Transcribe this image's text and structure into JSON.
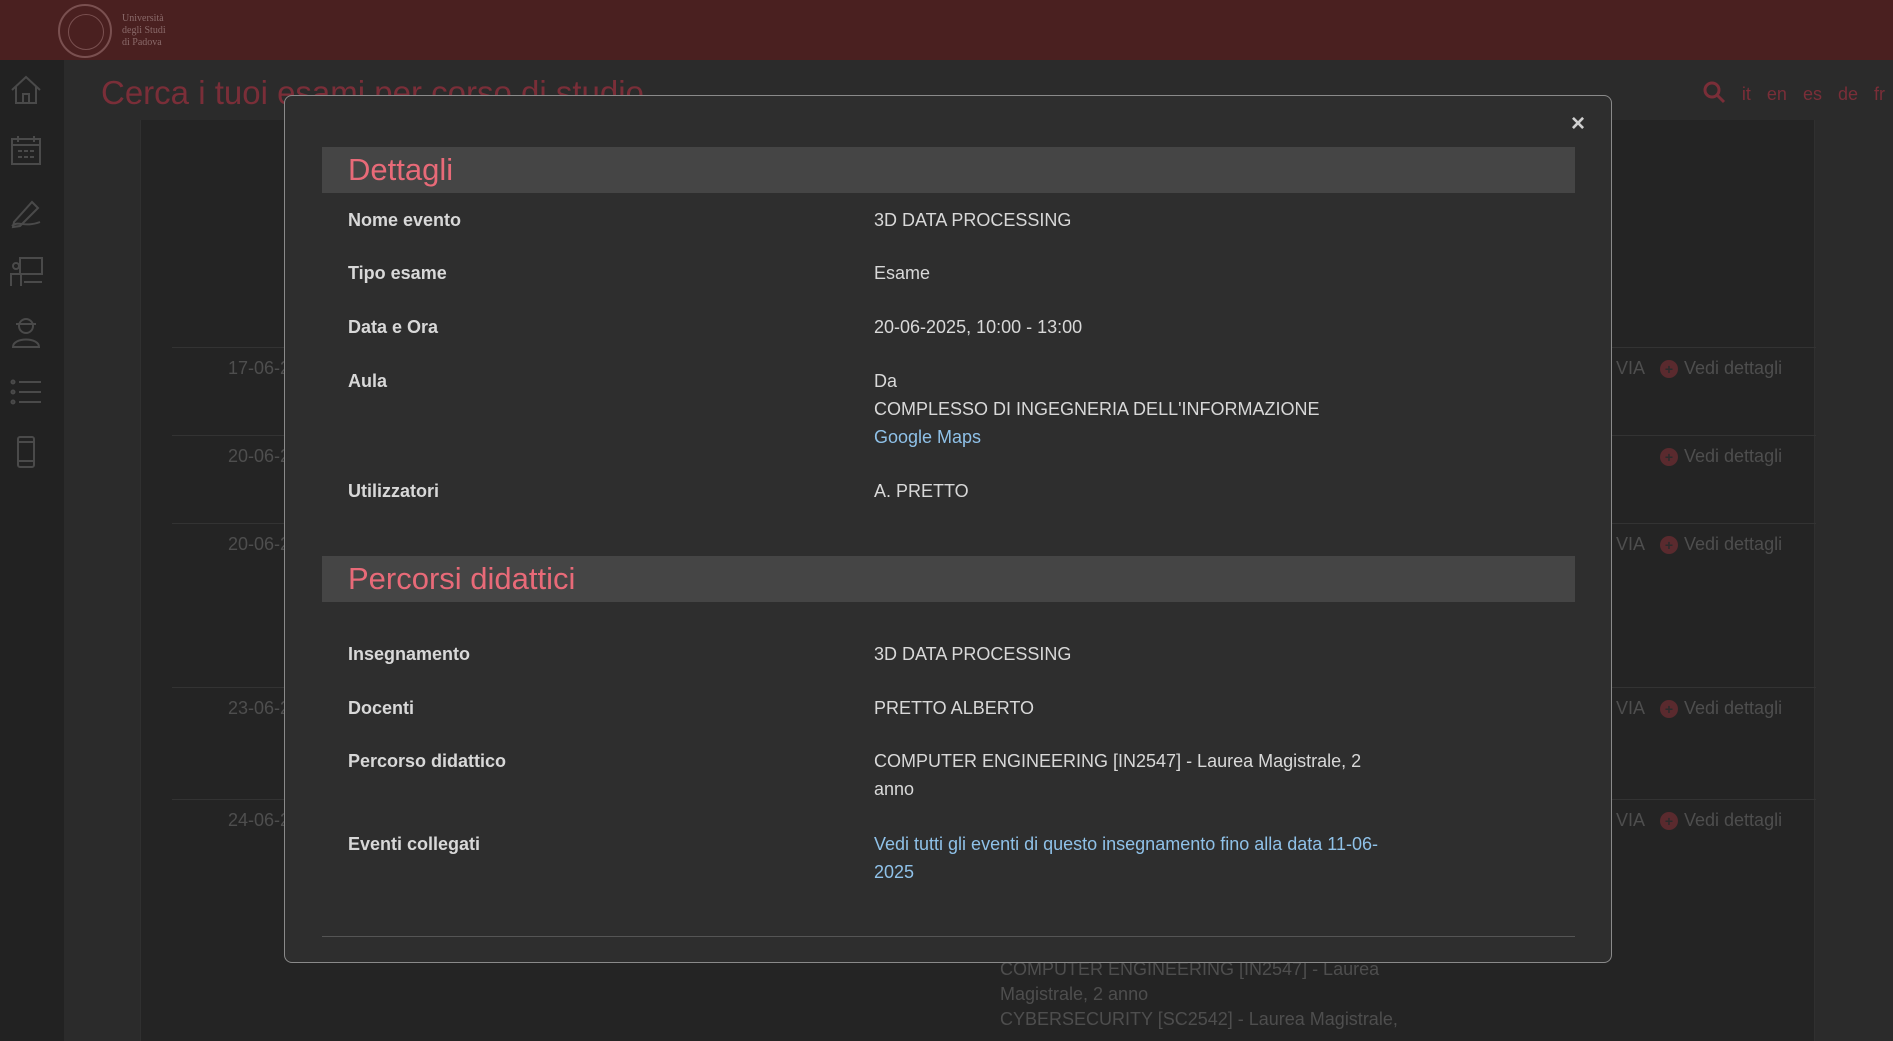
{
  "header": {
    "logo_lines": [
      "Università",
      "degli Studi",
      "di Padova"
    ]
  },
  "page": {
    "title": "Cerca i tuoi esami per corso di studio"
  },
  "languages": [
    "it",
    "en",
    "es",
    "de",
    "fr"
  ],
  "sidebar": {
    "icons": [
      "home-icon",
      "calendar-icon",
      "pen-icon",
      "classroom-icon",
      "student-icon",
      "list-icon",
      "mobile-icon"
    ]
  },
  "background_rows": [
    {
      "date": "17-06-2",
      "via": "VIA",
      "details": "Vedi dettagli"
    },
    {
      "date": "20-06-2",
      "via": "",
      "details": "Vedi dettagli"
    },
    {
      "date": "20-06-2",
      "via": "VIA",
      "details": "Vedi dettagli"
    },
    {
      "date": "23-06-2",
      "via": "VIA",
      "details": "Vedi dettagli"
    },
    {
      "date": "24-06-2",
      "via": "VIA",
      "details": "Vedi dettagli"
    }
  ],
  "background_bottom": [
    "COMPUTER ENGINEERING [IN2547] - Laurea",
    "Magistrale, 2 anno",
    "CYBERSECURITY [SC2542] - Laurea Magistrale,"
  ],
  "modal": {
    "close_label": "×",
    "details": {
      "heading": "Dettagli",
      "nome_evento_label": "Nome evento",
      "nome_evento_value": "3D DATA PROCESSING",
      "tipo_esame_label": "Tipo esame",
      "tipo_esame_value": "Esame",
      "data_ora_label": "Data e Ora",
      "data_ora_value": "20-06-2025, 10:00 - 13:00",
      "aula_label": "Aula",
      "aula_value_1": "Da",
      "aula_value_2": "COMPLESSO DI INGEGNERIA DELL'INFORMAZIONE",
      "aula_maps_link": "Google Maps",
      "utilizzatori_label": "Utilizzatori",
      "utilizzatori_value": "A. PRETTO"
    },
    "percorsi": {
      "heading": "Percorsi didattici",
      "insegnamento_label": "Insegnamento",
      "insegnamento_value": "3D DATA PROCESSING",
      "docenti_label": "Docenti",
      "docenti_value": "PRETTO ALBERTO",
      "percorso_label": "Percorso didattico",
      "percorso_value": "COMPUTER ENGINEERING [IN2547] - Laurea Magistrale, 2 anno",
      "eventi_label": "Eventi collegati",
      "eventi_link": "Vedi tutti gli eventi di questo insegnamento fino alla data 11-06-2025"
    }
  }
}
